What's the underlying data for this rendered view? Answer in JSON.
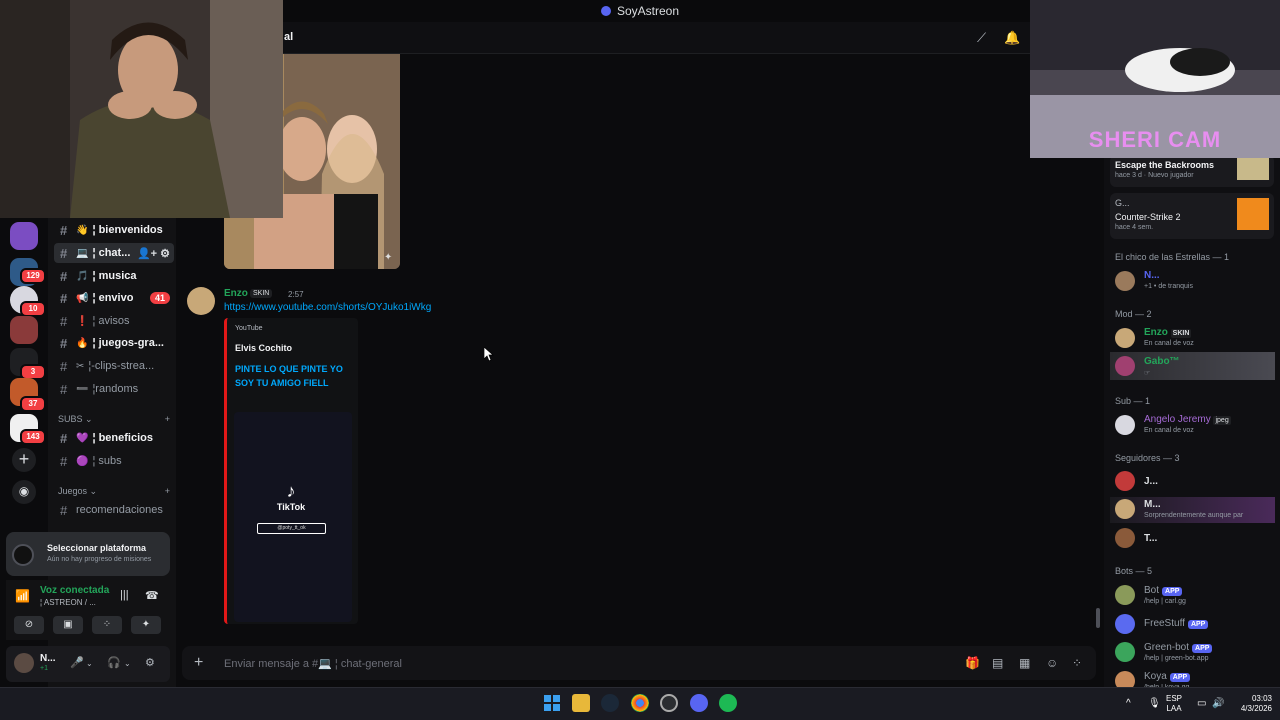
{
  "window": {
    "title": "SoyAstreon"
  },
  "header": {
    "channel_name": "al"
  },
  "rail": {
    "badges": [
      "129",
      "10",
      "3",
      "37",
      "143"
    ]
  },
  "channels": [
    {
      "emoji": "👋",
      "name": "¦ bienvenidos",
      "bold": true
    },
    {
      "emoji": "💻",
      "name": "¦ chat...",
      "bold": true,
      "active": true,
      "icons": "👤+ ⚙"
    },
    {
      "emoji": "🎵",
      "name": "¦ musica",
      "bold": true
    },
    {
      "emoji": "📢",
      "name": "¦ envivo",
      "bold": true,
      "badge": "41"
    },
    {
      "emoji": "❗",
      "name": "¦ avisos",
      "bold": false
    },
    {
      "emoji": "🔥",
      "name": "¦ juegos-gra...",
      "bold": true
    },
    {
      "emoji": "✂",
      "name": "¦-clips-strea...",
      "bold": false
    },
    {
      "emoji": "➖",
      "name": "¦randoms",
      "bold": false
    }
  ],
  "categories": {
    "subs": "SUBS",
    "juegos": "Juegos"
  },
  "subs_channels": [
    {
      "emoji": "💜",
      "name": "¦ beneficios",
      "bold": true
    },
    {
      "emoji": "🟣",
      "name": "¦ subs",
      "bold": false
    }
  ],
  "juegos_channels": [
    {
      "name": "recomendaciones"
    }
  ],
  "quest": {
    "title": "Seleccionar plataforma",
    "subtitle": "Aún no hay progreso de misiones"
  },
  "voice": {
    "status": "Voz conectada",
    "channel": "¦ ASTREON / ..."
  },
  "user": {
    "name": "N...",
    "status": "+1"
  },
  "message": {
    "author": "Enzo",
    "tag": "SKIN",
    "time": "2:57",
    "link": "https://www.youtube.com/shorts/OYJuko1iWkg",
    "embed": {
      "provider": "YouTube",
      "author": "Elvis Cochito",
      "title": "PINTE LO QUE PINTE YO SOY TU AMIGO FIELL",
      "video_brand": "TikTok",
      "video_user": "@poty_tt_ok"
    }
  },
  "input": {
    "placeholder": "Enviar mensaje a #💻 ¦ chat-general"
  },
  "activity_cards": [
    {
      "game": "Escape the Backrooms",
      "meta": "hace 3 d",
      "extra": "Nuevo jugador"
    },
    {
      "user": "G...",
      "game": "Counter-Strike 2",
      "meta": "hace 4 sem."
    }
  ],
  "member_groups": [
    {
      "label": "El chico de las Estrellas — 1",
      "members": [
        {
          "name": "N...",
          "sub": "+1 • de tranquis",
          "color": "#5865f2"
        }
      ]
    },
    {
      "label": "Mod — 2",
      "members": [
        {
          "name": "Enzo",
          "tag": "SKIN",
          "sub": "En canal de voz",
          "color": "#23a55a"
        },
        {
          "name": "Gabo™",
          "sub": "☞",
          "color": "#23a55a"
        }
      ]
    },
    {
      "label": "Sub — 1",
      "members": [
        {
          "name": "Angelo Jeremy",
          "tag": "jpeg",
          "sub": "En canal de voz",
          "color": "#a66bd6"
        }
      ]
    },
    {
      "label": "Seguidores — 3",
      "members": [
        {
          "name": "J...",
          "color": "#dbdee1"
        },
        {
          "name": "M...",
          "sub": "Sorprendentemente aunque par",
          "color": "#dbdee1"
        },
        {
          "name": "T...",
          "color": "#dbdee1"
        }
      ]
    },
    {
      "label": "Bots — 5",
      "members": [
        {
          "name": "Bot",
          "tag": "APP",
          "sub": "/help | carl.gg",
          "color": "#949ba4"
        },
        {
          "name": "FreeStuff",
          "tag": "APP",
          "color": "#949ba4"
        },
        {
          "name": "Green-bot",
          "tag": "APP",
          "sub": "/help | green-bot.app",
          "color": "#949ba4"
        },
        {
          "name": "Koya",
          "tag": "APP",
          "sub": "/help | koya.gg",
          "color": "#949ba4"
        }
      ]
    }
  ],
  "overlays": {
    "cam_label": "SHERI CAM"
  },
  "tray": {
    "lang_top": "ESP",
    "lang_bottom": "LAA",
    "time": "03:03",
    "date": "4/3/2026"
  },
  "colors": {
    "accent": "#5865f2",
    "online": "#23a55a",
    "danger": "#f23f43",
    "link": "#00a8fc"
  }
}
